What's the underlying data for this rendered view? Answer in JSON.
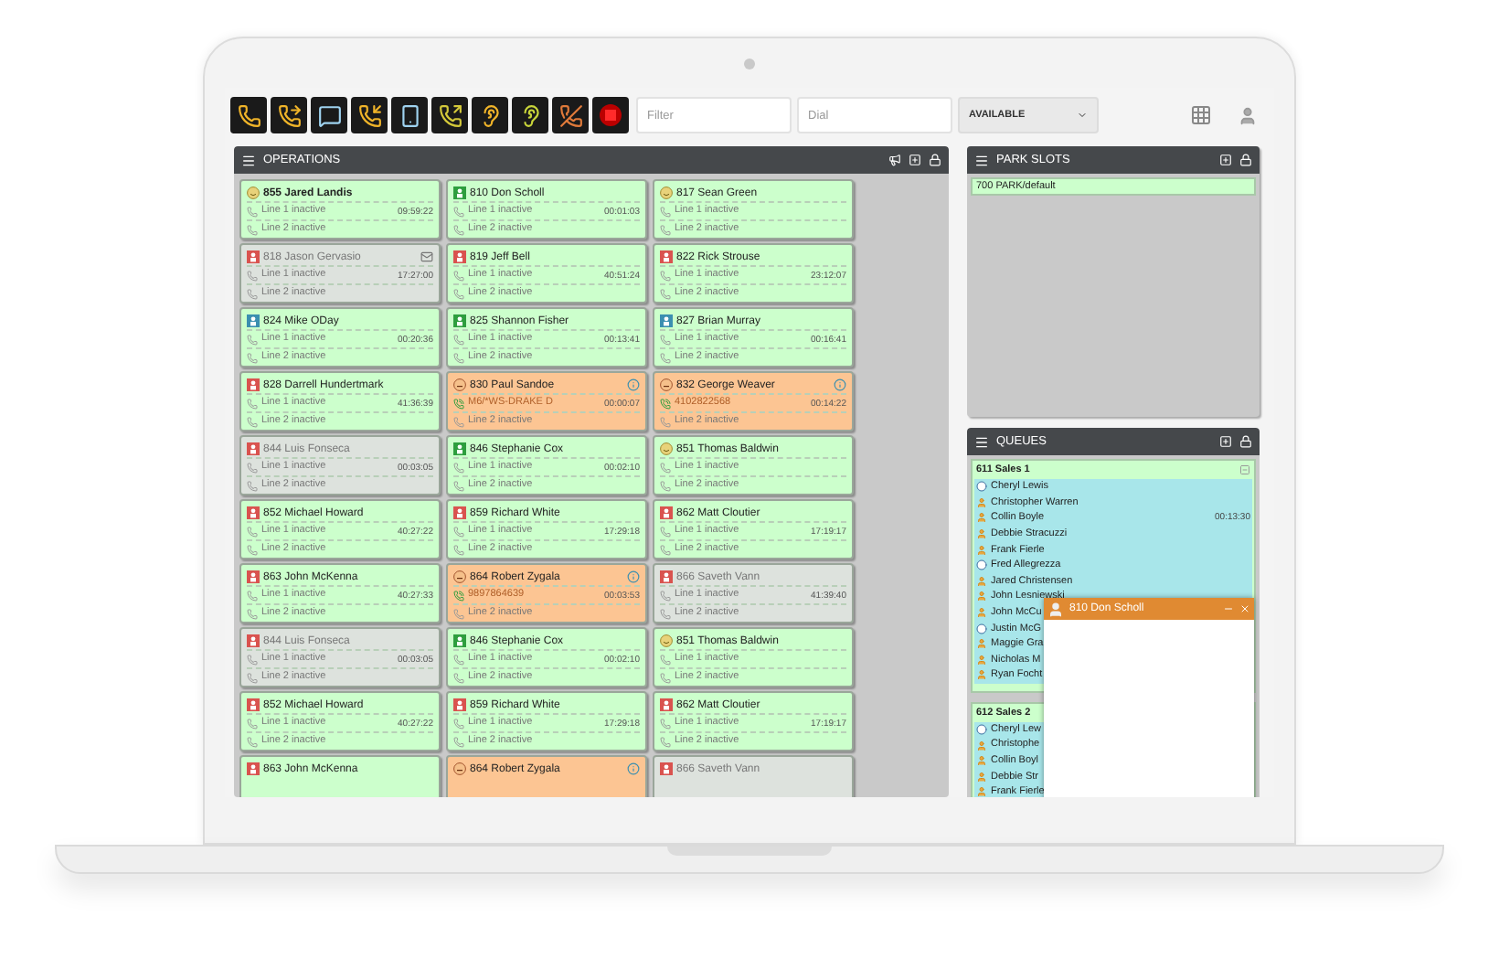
{
  "toolbar": {
    "filter": {
      "placeholder": "Filter"
    },
    "dial": {
      "placeholder": "Dial"
    },
    "status": "AVAILABLE"
  },
  "operations": {
    "title": "OPERATIONS",
    "cards": [
      {
        "name": "855 Jared Landis",
        "kind": "available",
        "selected": true,
        "disabled": false,
        "lines": [
          {
            "text": "Line 1 inactive",
            "time": "09:59:22",
            "active": false
          },
          {
            "text": "Line 2 inactive",
            "active": false
          }
        ]
      },
      {
        "name": "810 Don Scholl",
        "kind": "online",
        "selected": false,
        "disabled": false,
        "lines": [
          {
            "text": "Line 1 inactive",
            "time": "00:01:03",
            "active": false
          },
          {
            "text": "Line 2 inactive",
            "active": false
          }
        ]
      },
      {
        "name": "817 Sean Green",
        "kind": "available",
        "selected": false,
        "disabled": false,
        "lines": [
          {
            "text": "Line 1 inactive",
            "active": false
          },
          {
            "text": "Line 2 inactive",
            "active": false
          }
        ]
      },
      {
        "name": "818 Jason Gervasio",
        "kind": "dnd",
        "selected": false,
        "disabled": true,
        "badge": {
          "kind": "mail"
        },
        "lines": [
          {
            "text": "Line 1 inactive",
            "time": "17:27:00",
            "active": false
          },
          {
            "text": "Line 2 inactive",
            "active": false
          }
        ]
      },
      {
        "name": "819 Jeff Bell",
        "kind": "dnd",
        "selected": false,
        "disabled": false,
        "lines": [
          {
            "text": "Line 1 inactive",
            "time": "40:51:24",
            "active": false
          },
          {
            "text": "Line 2 inactive",
            "active": false
          }
        ]
      },
      {
        "name": "822 Rick Strouse",
        "kind": "dnd",
        "selected": false,
        "disabled": false,
        "lines": [
          {
            "text": "Line 1 inactive",
            "time": "23:12:07",
            "active": false
          },
          {
            "text": "Line 2 inactive",
            "active": false
          }
        ]
      },
      {
        "name": "824 Mike ODay",
        "kind": "away",
        "selected": false,
        "disabled": false,
        "lines": [
          {
            "text": "Line 1 inactive",
            "time": "00:20:36",
            "active": false
          },
          {
            "text": "Line 2 inactive",
            "active": false
          }
        ]
      },
      {
        "name": "825 Shannon Fisher",
        "kind": "online",
        "selected": false,
        "disabled": false,
        "lines": [
          {
            "text": "Line 1 inactive",
            "time": "00:13:41",
            "active": false
          },
          {
            "text": "Line 2 inactive",
            "active": false
          }
        ]
      },
      {
        "name": "827 Brian Murray",
        "kind": "away",
        "selected": false,
        "disabled": false,
        "lines": [
          {
            "text": "Line 1 inactive",
            "time": "00:16:41",
            "active": false
          },
          {
            "text": "Line 2 inactive",
            "active": false
          }
        ]
      },
      {
        "name": "828 Darrell Hundertmark",
        "kind": "dnd",
        "selected": false,
        "disabled": false,
        "lines": [
          {
            "text": "Line 1 inactive",
            "time": "41:36:39",
            "active": false
          },
          {
            "text": "Line 2 inactive",
            "active": false
          }
        ]
      },
      {
        "name": "830 Paul Sandoe",
        "kind": "on-call",
        "selected": false,
        "disabled": false,
        "badge": {
          "kind": "info"
        },
        "lines": [
          {
            "text": "M6/*WS-DRAKE D",
            "time": "00:00:07",
            "active": true
          },
          {
            "text": "Line 2 inactive",
            "active": false
          }
        ]
      },
      {
        "name": "832 George Weaver",
        "kind": "on-call",
        "selected": false,
        "disabled": false,
        "badge": {
          "kind": "info"
        },
        "lines": [
          {
            "text": "4102822568",
            "time": "00:14:22",
            "active": true
          },
          {
            "text": "Line 2 inactive",
            "active": false
          }
        ]
      },
      {
        "name": "844 Luis Fonseca",
        "kind": "dnd",
        "selected": false,
        "disabled": true,
        "lines": [
          {
            "text": "Line 1 inactive",
            "time": "00:03:05",
            "active": false
          },
          {
            "text": "Line 2 inactive",
            "active": false
          }
        ]
      },
      {
        "name": "846 Stephanie Cox",
        "kind": "online",
        "selected": false,
        "disabled": false,
        "lines": [
          {
            "text": "Line 1 inactive",
            "time": "00:02:10",
            "active": false
          },
          {
            "text": "Line 2 inactive",
            "active": false
          }
        ]
      },
      {
        "name": "851 Thomas Baldwin",
        "kind": "available",
        "selected": false,
        "disabled": false,
        "lines": [
          {
            "text": "Line 1 inactive",
            "active": false
          },
          {
            "text": "Line 2 inactive",
            "active": false
          }
        ]
      },
      {
        "name": "852 Michael Howard",
        "kind": "dnd",
        "selected": false,
        "disabled": false,
        "lines": [
          {
            "text": "Line 1 inactive",
            "time": "40:27:22",
            "active": false
          },
          {
            "text": "Line 2 inactive",
            "active": false
          }
        ]
      },
      {
        "name": "859 Richard White",
        "kind": "dnd",
        "selected": false,
        "disabled": false,
        "lines": [
          {
            "text": "Line 1 inactive",
            "time": "17:29:18",
            "active": false
          },
          {
            "text": "Line 2 inactive",
            "active": false
          }
        ]
      },
      {
        "name": "862 Matt Cloutier",
        "kind": "dnd",
        "selected": false,
        "disabled": false,
        "lines": [
          {
            "text": "Line 1 inactive",
            "time": "17:19:17",
            "active": false
          },
          {
            "text": "Line 2 inactive",
            "active": false
          }
        ]
      },
      {
        "name": "863 John McKenna",
        "kind": "dnd",
        "selected": false,
        "disabled": false,
        "lines": [
          {
            "text": "Line 1 inactive",
            "time": "40:27:33",
            "active": false
          },
          {
            "text": "Line 2 inactive",
            "active": false
          }
        ]
      },
      {
        "name": "864 Robert Zygala",
        "kind": "on-call",
        "selected": false,
        "disabled": false,
        "badge": {
          "kind": "info"
        },
        "lines": [
          {
            "text": "9897864639",
            "time": "00:03:53",
            "active": true
          },
          {
            "text": "Line 2 inactive",
            "active": false
          }
        ]
      },
      {
        "name": "866 Saveth Vann",
        "kind": "dnd",
        "selected": false,
        "disabled": true,
        "lines": [
          {
            "text": "Line 1 inactive",
            "time": "41:39:40",
            "active": false
          },
          {
            "text": "Line 2 inactive",
            "active": false
          }
        ]
      },
      {
        "name": "844 Luis Fonseca",
        "kind": "dnd",
        "selected": false,
        "disabled": true,
        "lines": [
          {
            "text": "Line 1 inactive",
            "time": "00:03:05",
            "active": false
          },
          {
            "text": "Line 2 inactive",
            "active": false
          }
        ]
      },
      {
        "name": "846 Stephanie Cox",
        "kind": "online",
        "selected": false,
        "disabled": false,
        "lines": [
          {
            "text": "Line 1 inactive",
            "time": "00:02:10",
            "active": false
          },
          {
            "text": "Line 2 inactive",
            "active": false
          }
        ]
      },
      {
        "name": "851 Thomas Baldwin",
        "kind": "available",
        "selected": false,
        "disabled": false,
        "lines": [
          {
            "text": "Line 1 inactive",
            "active": false
          },
          {
            "text": "Line 2 inactive",
            "active": false
          }
        ]
      },
      {
        "name": "852 Michael Howard",
        "kind": "dnd",
        "selected": false,
        "disabled": false,
        "lines": [
          {
            "text": "Line 1 inactive",
            "time": "40:27:22",
            "active": false
          },
          {
            "text": "Line 2 inactive",
            "active": false
          }
        ]
      },
      {
        "name": "859 Richard White",
        "kind": "dnd",
        "selected": false,
        "disabled": false,
        "lines": [
          {
            "text": "Line 1 inactive",
            "time": "17:29:18",
            "active": false
          },
          {
            "text": "Line 2 inactive",
            "active": false
          }
        ]
      },
      {
        "name": "862 Matt Cloutier",
        "kind": "dnd",
        "selected": false,
        "disabled": false,
        "lines": [
          {
            "text": "Line 1 inactive",
            "time": "17:19:17",
            "active": false
          },
          {
            "text": "Line 2 inactive",
            "active": false
          }
        ]
      },
      {
        "name": "863 John McKenna",
        "kind": "dnd",
        "selected": false,
        "disabled": false
      },
      {
        "name": "864 Robert Zygala",
        "kind": "on-call",
        "selected": false,
        "disabled": false,
        "badge": {
          "kind": "info"
        }
      },
      {
        "name": "866 Saveth Vann",
        "kind": "dnd",
        "selected": false,
        "disabled": true
      }
    ]
  },
  "park_slots": {
    "title": "PARK SLOTS",
    "items": [
      "700 PARK/default"
    ]
  },
  "queues": {
    "title": "QUEUES",
    "items": [
      {
        "name": "611 Sales 1",
        "members": [
          {
            "name": "Cheryl Lewis",
            "kind": "waiting"
          },
          {
            "name": "Christopher Warren",
            "kind": "agent"
          },
          {
            "name": "Collin Boyle",
            "kind": "agent",
            "time": "00:13:30"
          },
          {
            "name": "Debbie Stracuzzi",
            "kind": "agent"
          },
          {
            "name": "Frank Fierle",
            "kind": "agent"
          },
          {
            "name": "Fred Allegrezza",
            "kind": "waiting"
          },
          {
            "name": "Jared Christensen",
            "kind": "agent"
          },
          {
            "name": "John Lesniewski",
            "kind": "agent"
          },
          {
            "name": "John McCu",
            "kind": "agent"
          },
          {
            "name": "Justin McG",
            "kind": "waiting"
          },
          {
            "name": "Maggie Gra",
            "kind": "agent"
          },
          {
            "name": "Nicholas M",
            "kind": "agent"
          },
          {
            "name": "Ryan Focht",
            "kind": "agent"
          }
        ]
      },
      {
        "name": "612 Sales 2",
        "members": [
          {
            "name": "Cheryl Lew",
            "kind": "waiting"
          },
          {
            "name": "Christophe",
            "kind": "agent"
          },
          {
            "name": "Collin Boyl",
            "kind": "agent"
          },
          {
            "name": "Debbie Str",
            "kind": "agent"
          },
          {
            "name": "Frank Fierle",
            "kind": "agent"
          }
        ]
      }
    ]
  },
  "chat": {
    "title": "810 Don Scholl"
  }
}
